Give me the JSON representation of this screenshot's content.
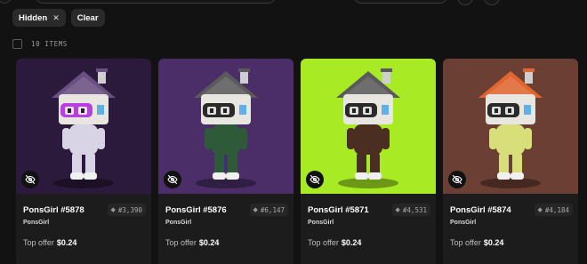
{
  "filters": {
    "chips": [
      {
        "label": "Hidden",
        "close": "✕"
      },
      {
        "label": "Clear"
      }
    ]
  },
  "items": {
    "count_label": "10 ITEMS"
  },
  "currency_symbol": "◆",
  "cards": [
    {
      "name": "PonsGirl #5878",
      "price": "#3,390",
      "collection": "PonsGirl",
      "offer_label": "Top offer",
      "offer_value": "$0.24",
      "bg_color": "#2c1a3c",
      "roof_color": "#6a4f82",
      "body_color": "#d9d3e6",
      "visor_color": "#b83fe0"
    },
    {
      "name": "PonsGirl #5876",
      "price": "#6,147",
      "collection": "PonsGirl",
      "offer_label": "Top offer",
      "offer_value": "$0.24",
      "bg_color": "#4b2e68",
      "roof_color": "#5a5a5a",
      "body_color": "#2f5a3a",
      "visor_color": "#2a2a2a"
    },
    {
      "name": "PonsGirl #5871",
      "price": "#4,531",
      "collection": "PonsGirl",
      "offer_label": "Top offer",
      "offer_value": "$0.24",
      "bg_color": "#a8ea24",
      "roof_color": "#5a5a5a",
      "body_color": "#4a2e22",
      "visor_color": "#2a2a2a"
    },
    {
      "name": "PonsGirl #5874",
      "price": "#4,184",
      "collection": "PonsGirl",
      "offer_label": "Top offer",
      "offer_value": "$0.24",
      "bg_color": "#6b3f33",
      "roof_color": "#e0662f",
      "body_color": "#d8df7a",
      "visor_color": "#2a2a2a"
    }
  ]
}
